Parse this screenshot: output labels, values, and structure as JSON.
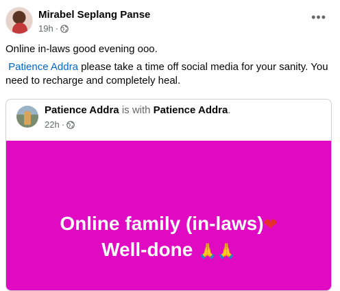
{
  "post": {
    "author": "Mirabel Seplang Panse",
    "time": "19h",
    "separator": "·",
    "more_label": "•••",
    "text_line1": "Online in-laws good evening ooo.",
    "mention": "Patience Addra",
    "text_line2_rest": " please take a time off social media for your sanity. You need to recharge and completely heal."
  },
  "shared": {
    "author": "Patience Addra",
    "with_text": " is with ",
    "with_name": "Patience Addra",
    "period": ".",
    "time": "22h",
    "separator": "·",
    "graphic_line1": "Online family (in-laws)",
    "graphic_heart": "❤",
    "graphic_line2": "Well-done ",
    "graphic_hands": "🙏🙏"
  },
  "colors": {
    "graphic_background": "#e10ac3",
    "mention_link": "#0064d1"
  }
}
